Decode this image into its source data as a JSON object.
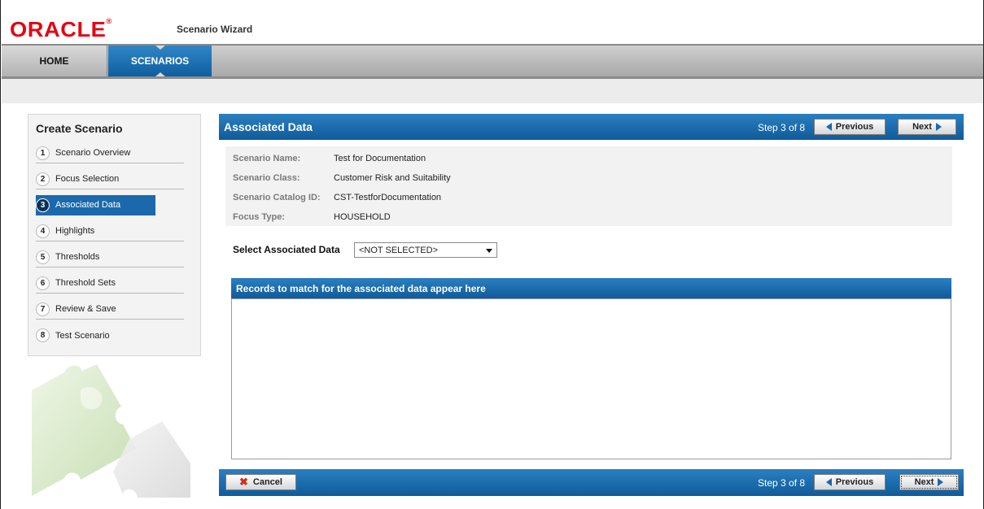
{
  "header": {
    "logo_text": "ORACLE",
    "app_title": "Scenario Wizard"
  },
  "nav": {
    "tabs": [
      {
        "label": "HOME"
      },
      {
        "label": "SCENARIOS"
      }
    ]
  },
  "sidebar": {
    "title": "Create Scenario",
    "steps": [
      {
        "num": "1",
        "label": "Scenario Overview"
      },
      {
        "num": "2",
        "label": "Focus Selection"
      },
      {
        "num": "3",
        "label": "Associated Data"
      },
      {
        "num": "4",
        "label": "Highlights"
      },
      {
        "num": "5",
        "label": "Thresholds"
      },
      {
        "num": "6",
        "label": "Threshold Sets"
      },
      {
        "num": "7",
        "label": "Review & Save"
      },
      {
        "num": "8",
        "label": "Test Scenario"
      }
    ]
  },
  "main": {
    "title": "Associated Data",
    "step_text": "Step 3 of 8",
    "previous_label": "Previous",
    "next_label": "Next",
    "cancel_label": "Cancel",
    "details": {
      "name_label": "Scenario Name:",
      "name_value": "Test for Documentation",
      "class_label": "Scenario Class:",
      "class_value": "Customer Risk and Suitability",
      "catalog_label": "Scenario Catalog ID:",
      "catalog_value": "CST-TestforDocumentation",
      "focus_label": "Focus Type:",
      "focus_value": "HOUSEHOLD"
    },
    "select": {
      "label": "Select Associated Data",
      "value": "<NOT SELECTED>"
    },
    "records_title": "Records to match for the associated data appear here"
  },
  "colors": {
    "brand_red": "#e30613",
    "accent_blue": "#1b69ac"
  }
}
